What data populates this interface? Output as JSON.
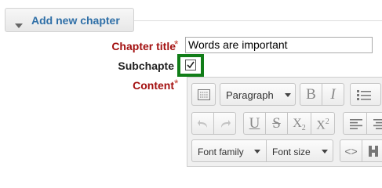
{
  "section": {
    "legend_title": "Add new chapter"
  },
  "form": {
    "chapter_title_label": "Chapter title",
    "chapter_title_value": "Words are important",
    "subchapter_label": "Subchapte",
    "subchapter_checked": true,
    "content_label": "Content",
    "required_mark": "*"
  },
  "editor": {
    "toolbar_row1": {
      "paragraph_select": "Paragraph",
      "bold": "B",
      "italic": "I"
    },
    "toolbar_row2": {
      "underline": "U",
      "strikethrough": "S",
      "subscript_base": "X",
      "subscript_sub": "2",
      "superscript_base": "X",
      "superscript_sup": "2"
    },
    "toolbar_row3": {
      "font_family_select": "Font family",
      "font_size_select": "Font size",
      "code": "<>"
    }
  },
  "colors": {
    "legend_link": "#2f6fa7",
    "required_label": "#a31010",
    "highlight_box": "#117d18"
  }
}
